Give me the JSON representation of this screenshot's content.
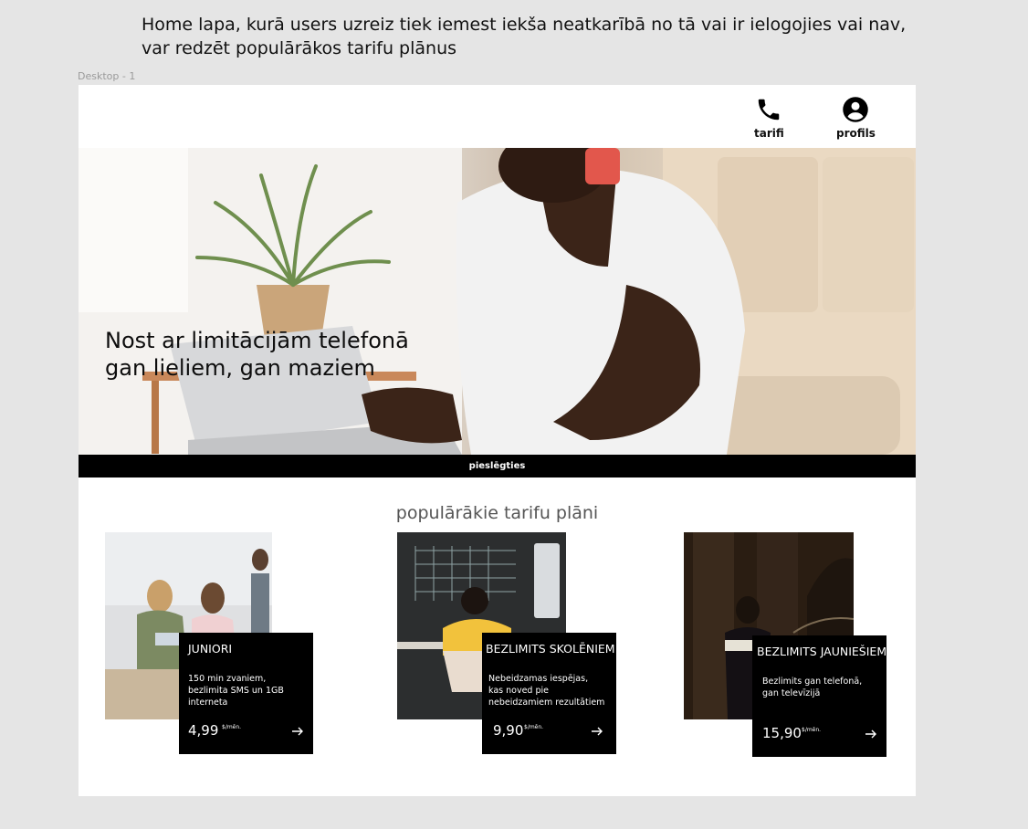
{
  "annotation": {
    "line1": "Home lapa, kurā users uzreiz tiek iemest iekša neatkarībā no tā vai ir ielogojies vai nav,",
    "line2": "var redzēt populārākos tarifu plānus"
  },
  "frame_label": "Desktop - 1",
  "nav": {
    "tarifi_label": "tarifi",
    "profils_label": "profils"
  },
  "hero": {
    "title_line1": "Nost ar limitācijām telefonā",
    "title_line2": "gan lieliem, gan maziem"
  },
  "connect_label": "pieslēgties",
  "plans_heading": "populārākie tarifu plāni",
  "plans": [
    {
      "name": "JUNIORI",
      "description": "150 min zvaniem, bezlimita SMS un 1GB interneta",
      "price": "4,99",
      "unit": "$/mēn."
    },
    {
      "name": "BEZLIMITS SKOLĒNIEM",
      "description": "Nebeidzamas iespējas, kas noved pie nebeidzamiem rezultātiem",
      "price": "9,90",
      "unit": "$/mēn."
    },
    {
      "name": "BEZLIMITS JAUNIEŠIEM",
      "description": "Bezlimits gan telefonā, gan televīzijā",
      "price": "15,90",
      "unit": "$/mēn."
    }
  ],
  "colors": {
    "canvas": "#e5e5e5",
    "frame": "#ffffff",
    "card": "#000000",
    "heading_gray": "#555555"
  },
  "icons": {
    "tarifi": "phone-icon",
    "profils": "user-circle-icon",
    "plan_arrow": "arrow-right-icon"
  }
}
